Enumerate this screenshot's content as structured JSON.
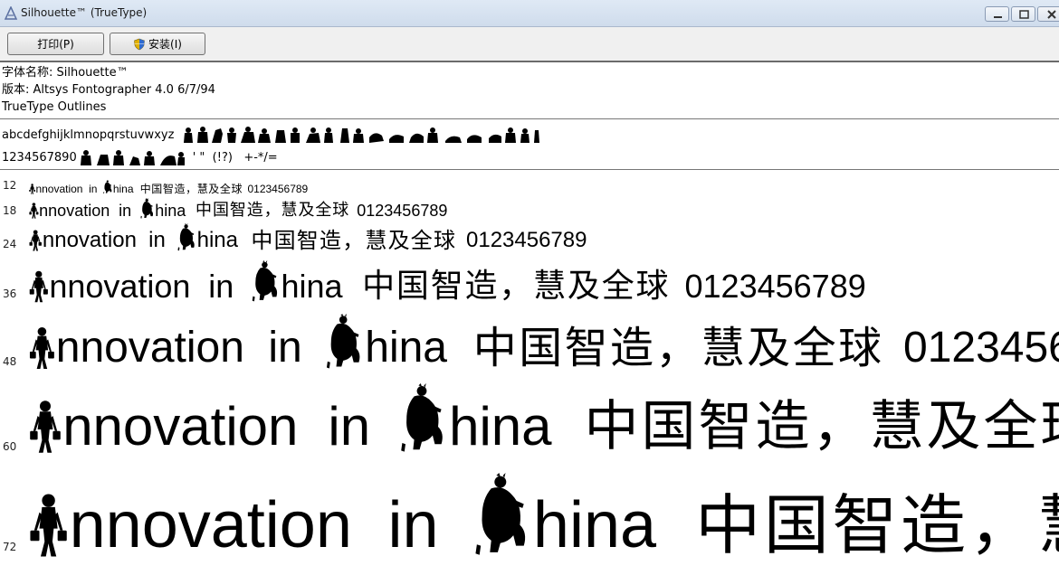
{
  "window": {
    "title": "Silhouette™ (TrueType)",
    "controls": [
      "minimize-icon",
      "maximize-icon",
      "close-icon"
    ]
  },
  "toolbar": {
    "print_label": "打印(P)",
    "install_label": "安装(I)"
  },
  "info": {
    "font_name": "字体名称: Silhouette™",
    "version": "版本: Altsys Fontographer 4.0 6/7/94",
    "outline": "TrueType Outlines"
  },
  "charset": {
    "lowercase": "abcdefghijklmnopqrstuvwxyz",
    "digits": "1234567890",
    "symbols": "' \"  (!?)   +-*/="
  },
  "sample": {
    "word1": "nnovation",
    "word2": "in",
    "word3": "hina",
    "cjk": "中国智造，慧及全球",
    "digits": "0123456789"
  },
  "sizes": [
    "12",
    "18",
    "24",
    "36",
    "48",
    "60",
    "72"
  ],
  "colors": {
    "titlebar": "#dfe9f5",
    "toolbar": "#f0f0f0",
    "rule": "#777777"
  }
}
